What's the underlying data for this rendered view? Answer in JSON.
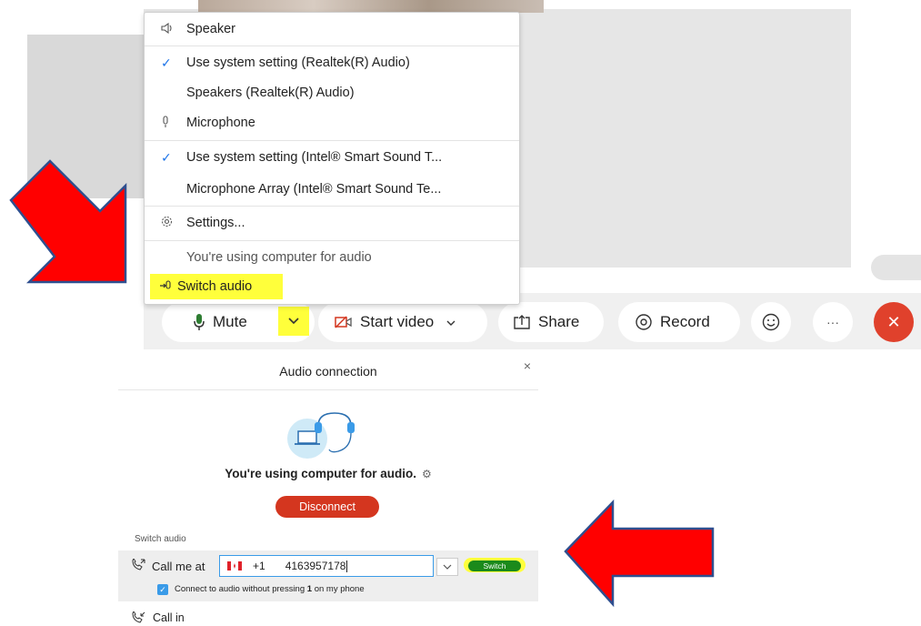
{
  "menu": {
    "speaker_header": "Speaker",
    "speaker_system": "Use system setting (Realtek(R) Audio)",
    "speaker_device": "Speakers (Realtek(R) Audio)",
    "microphone_header": "Microphone",
    "mic_system": "Use system setting (Intel® Smart Sound T...",
    "mic_device": "Microphone Array (Intel® Smart Sound Te...",
    "settings": "Settings...",
    "status": "You're using computer for audio",
    "switch_audio": "Switch audio"
  },
  "controls": {
    "mute": "Mute",
    "start_video": "Start video",
    "share": "Share",
    "record": "Record",
    "more": "···",
    "end": "✕"
  },
  "dialog": {
    "title": "Audio connection",
    "close": "×",
    "message": "You're using computer for audio.",
    "disconnect": "Disconnect",
    "switch_label": "Switch audio",
    "call_me_at": "Call me at",
    "country_code": "+1",
    "phone_value": "4163957178",
    "switch_button": "Switch",
    "connect_pre": "Connect to audio without pressing ",
    "connect_key": "1",
    "connect_post": " on my phone",
    "call_in": "Call in"
  },
  "colors": {
    "highlight": "#ffff3b",
    "arrow_fill": "#ff0000",
    "arrow_stroke": "#2f4f8f",
    "end_call": "#e0412c",
    "disconnect": "#d4361f",
    "switch_green": "#1b8a1b",
    "accent_blue": "#1b73e8"
  }
}
